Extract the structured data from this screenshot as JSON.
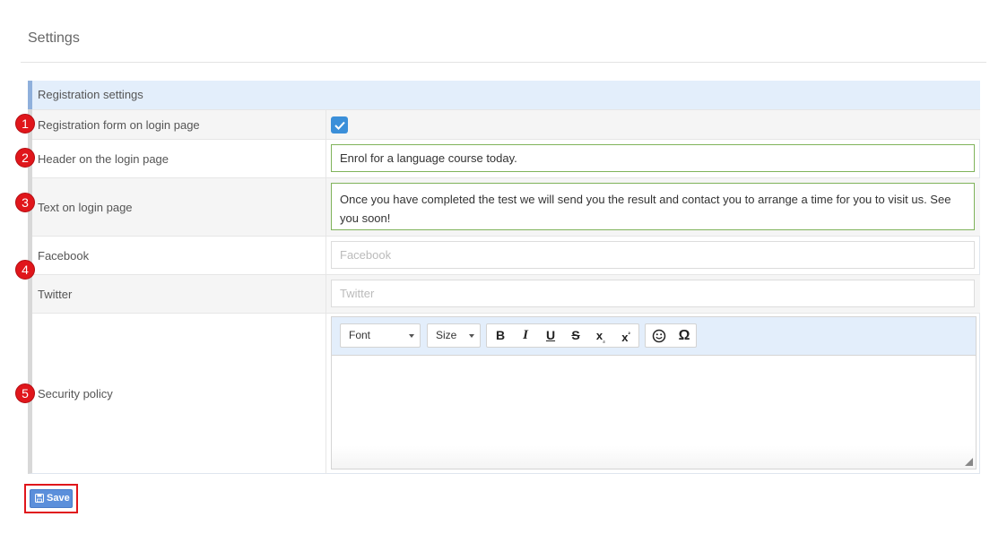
{
  "page": {
    "title": "Settings"
  },
  "panel": {
    "header": "Registration settings"
  },
  "rows": {
    "registration_form": {
      "label": "Registration form on login page",
      "checked": true
    },
    "header": {
      "label": "Header on the login page",
      "value": "Enrol for a language course today."
    },
    "text": {
      "label": "Text on login page",
      "value": "Once you have completed the test we will send you the result and contact you to arrange a time for you to visit us. See you soon!"
    },
    "facebook": {
      "label": "Facebook",
      "placeholder": "Facebook",
      "value": ""
    },
    "twitter": {
      "label": "Twitter",
      "placeholder": "Twitter",
      "value": ""
    },
    "security": {
      "label": "Security policy"
    }
  },
  "editor": {
    "font_label": "Font",
    "size_label": "Size",
    "buttons": [
      "bold",
      "italic",
      "underline",
      "strikethrough",
      "subscript",
      "superscript",
      "emoji",
      "special-character"
    ],
    "content": ""
  },
  "annotations": [
    "1",
    "2",
    "3",
    "4",
    "5"
  ],
  "save": {
    "label": "Save"
  },
  "colors": {
    "accent": "#3b8fd9",
    "save": "#5b8fdb",
    "annotation": "#e0161b",
    "valid_border": "#7fb35a",
    "header_bg": "#e3eefb"
  }
}
